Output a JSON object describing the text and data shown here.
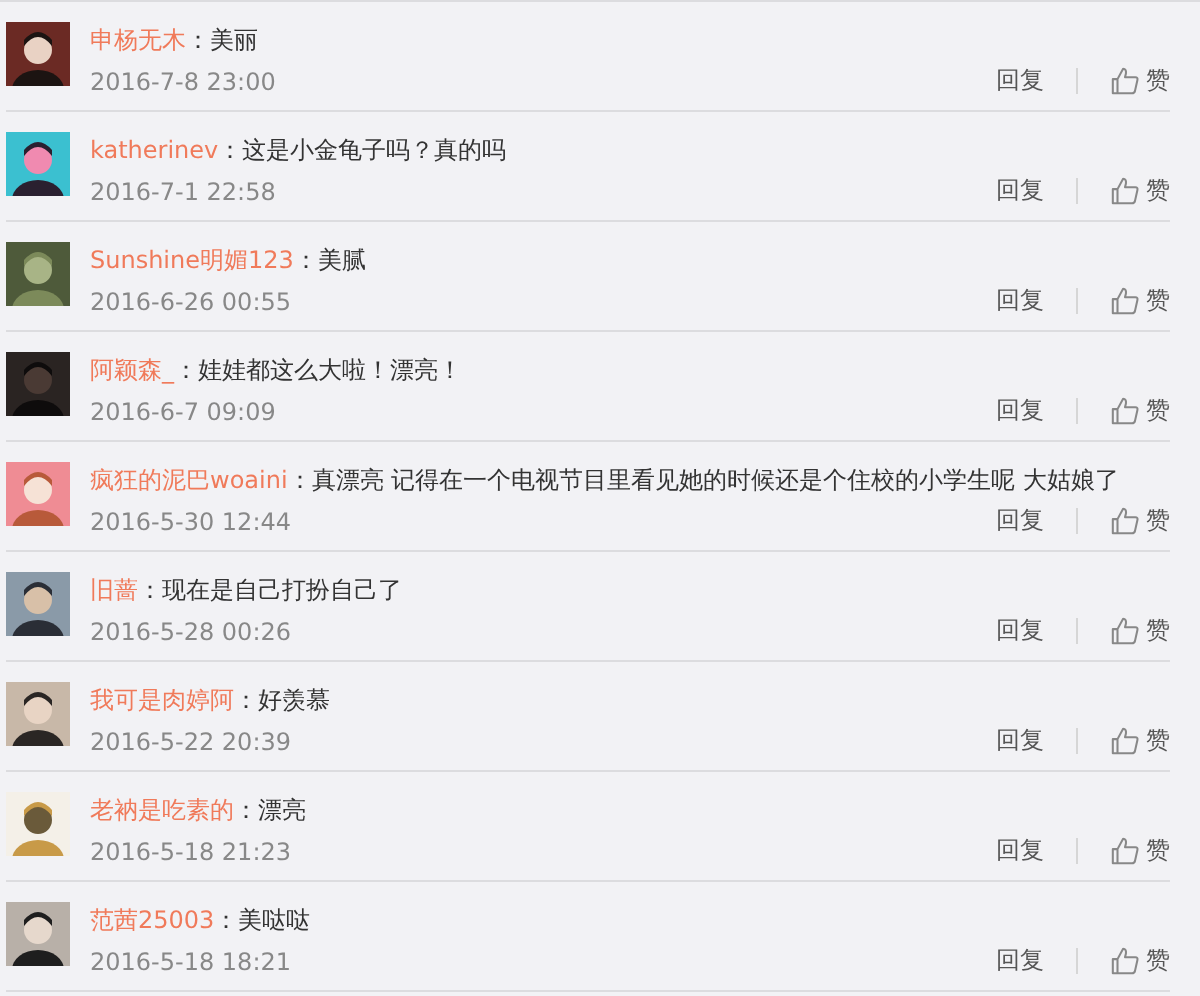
{
  "comments": [
    {
      "user": "申杨无木",
      "text": "：美丽",
      "time": "2016-7-8 23:00",
      "reply": "回复",
      "like": "赞"
    },
    {
      "user": "katherinev",
      "text": "：这是小金龟子吗？真的吗",
      "time": "2016-7-1 22:58",
      "reply": "回复",
      "like": "赞"
    },
    {
      "user": "Sunshine明媚123",
      "text": "：美腻",
      "time": "2016-6-26 00:55",
      "reply": "回复",
      "like": "赞"
    },
    {
      "user": "阿颖森_",
      "text": "：娃娃都这么大啦！漂亮！",
      "time": "2016-6-7 09:09",
      "reply": "回复",
      "like": "赞"
    },
    {
      "user": "疯狂的泥巴woaini",
      "text": "：真漂亮 记得在一个电视节目里看见她的时候还是个住校的小学生呢 大姑娘了",
      "time": "2016-5-30 12:44",
      "reply": "回复",
      "like": "赞"
    },
    {
      "user": "旧蔷",
      "text": "：现在是自己打扮自己了",
      "time": "2016-5-28 00:26",
      "reply": "回复",
      "like": "赞"
    },
    {
      "user": "我可是肉婷阿",
      "text": "：好羡慕",
      "time": "2016-5-22 20:39",
      "reply": "回复",
      "like": "赞"
    },
    {
      "user": "老衲是吃素的",
      "text": "：漂亮",
      "time": "2016-5-18 21:23",
      "reply": "回复",
      "like": "赞"
    },
    {
      "user": "范茜25003",
      "text": "：美哒哒",
      "time": "2016-5-18 18:21",
      "reply": "回复",
      "like": "赞"
    }
  ]
}
